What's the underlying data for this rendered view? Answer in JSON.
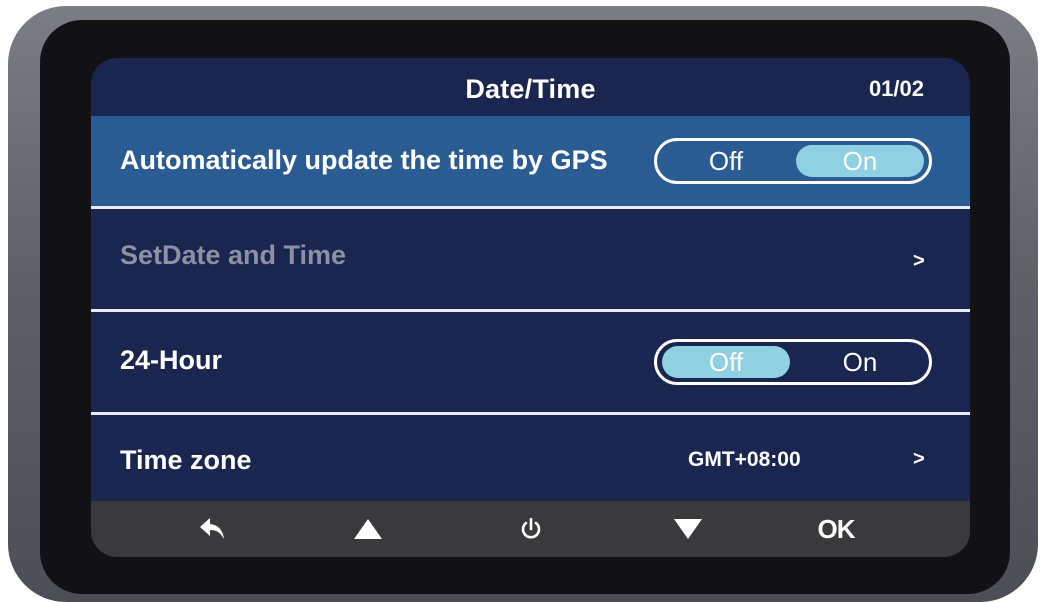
{
  "header": {
    "title": "Date/Time",
    "page_indicator": "01/02"
  },
  "menu": {
    "items": [
      {
        "label": "Automatically update the time by GPS",
        "type": "toggle",
        "selected": true,
        "options": [
          "Off",
          "On"
        ],
        "value": "On"
      },
      {
        "label": "SetDate and Time",
        "type": "submenu",
        "disabled": true,
        "chevron": ">"
      },
      {
        "label": "24-Hour",
        "type": "toggle",
        "options": [
          "Off",
          "On"
        ],
        "value": "Off"
      },
      {
        "label": "Time zone",
        "type": "submenu",
        "value": "GMT+08:00",
        "chevron": ">"
      }
    ]
  },
  "footer": {
    "buttons": [
      {
        "icon": "back-arrow-icon"
      },
      {
        "icon": "up-triangle-icon"
      },
      {
        "icon": "power-icon"
      },
      {
        "icon": "down-triangle-icon"
      },
      {
        "icon": "ok",
        "label": "OK"
      }
    ]
  },
  "colors": {
    "screen_background": "#1a2550",
    "selected_row": "#2b5b93",
    "toggle_active": "#8fd0e3",
    "footer_background": "#3a3a3c",
    "disabled_text": "#8c91a4"
  }
}
